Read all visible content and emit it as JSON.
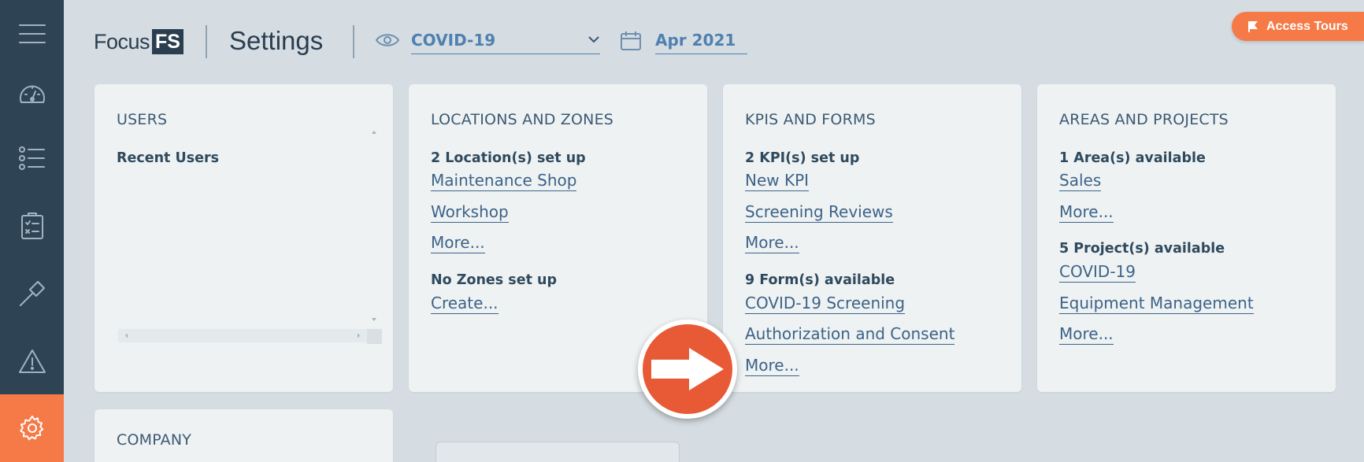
{
  "header": {
    "logo_text": "Focus",
    "logo_box": "FS",
    "page_title": "Settings",
    "project_value": "COVID-19",
    "date_value": "Apr 2021",
    "tours_label": "Access Tours"
  },
  "sidebar": {
    "items": [
      {
        "icon": "hamburger-menu-icon"
      },
      {
        "icon": "dashboard-gauge-icon"
      },
      {
        "icon": "list-icon"
      },
      {
        "icon": "clipboard-checklist-icon"
      },
      {
        "icon": "hammer-icon"
      },
      {
        "icon": "warning-icon"
      },
      {
        "icon": "gear-icon",
        "active": true
      }
    ]
  },
  "cards": {
    "users": {
      "title": "USERS",
      "recent_label": "Recent Users"
    },
    "locations": {
      "title": "LOCATIONS AND ZONES",
      "locations_label": "2 Location(s) set up",
      "links": [
        "Maintenance Shop",
        "Workshop",
        "More..."
      ],
      "zones_label": "No Zones set up",
      "zones_link": "Create..."
    },
    "kpis": {
      "title": "KPIS AND FORMS",
      "kpis_label": "2 KPI(s) set up",
      "kpi_links": [
        "New KPI",
        "Screening Reviews",
        "More..."
      ],
      "forms_label": "9 Form(s) available",
      "form_links": [
        "COVID-19 Screening",
        "Authorization and Consent",
        "More..."
      ]
    },
    "areas": {
      "title": "AREAS AND PROJECTS",
      "areas_label": "1 Area(s) available",
      "area_links": [
        "Sales",
        "More..."
      ],
      "projects_label": "5 Project(s) available",
      "project_links": [
        "COVID-19",
        "Equipment Management",
        "More..."
      ]
    },
    "company": {
      "title": "COMPANY"
    }
  },
  "colors": {
    "accent": "#f57a47",
    "sidebar_bg": "#2e4354",
    "link": "#3d6388",
    "background": "#d5dde3"
  }
}
